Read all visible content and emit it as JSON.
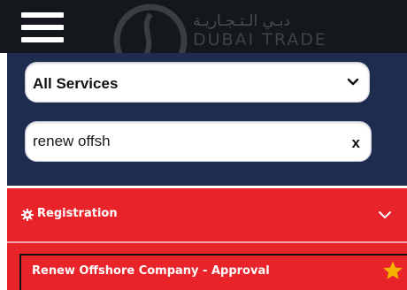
{
  "header": {
    "logo_arabic": "دبـي الـتـجـاريـة",
    "logo_latin": "DUBAI TRADE"
  },
  "filters": {
    "service_select": {
      "selected": "All Services"
    },
    "search": {
      "value": "renew offsh",
      "clear_label": "x"
    }
  },
  "accordion": {
    "label": "Registration",
    "icon": "gear-icon",
    "expand_icon": "chevron-down-icon"
  },
  "results": [
    {
      "label": "Renew Offshore Company - Approval",
      "favorite_icon": "star-icon"
    }
  ],
  "colors": {
    "header_bg": "#14171c",
    "navy": "#1d2c4f",
    "accent_red": "#e8232a",
    "star": "#f5b400"
  }
}
